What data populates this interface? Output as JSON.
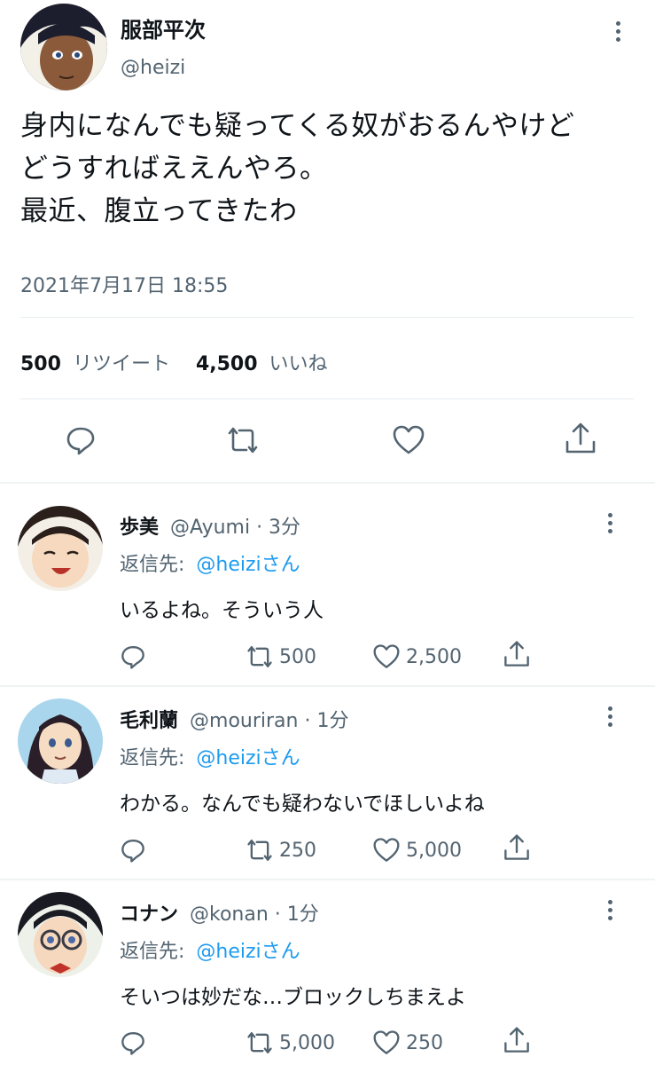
{
  "main_tweet": {
    "display_name": "服部平次",
    "handle": "@heizi",
    "text_lines": [
      "身内になんでも疑ってくる奴がおるんやけど",
      "どうすればええんやろ。",
      "最近、腹立ってきたわ"
    ],
    "timestamp": "2021年7月17日 18:55",
    "retweet_count": "500",
    "retweet_label": "リツイート",
    "like_count": "4,500",
    "like_label": "いいね"
  },
  "replies": [
    {
      "display_name": "歩美",
      "handle_time": "@Ayumi · 3分",
      "reply_prefix": "返信先:",
      "reply_to": "@heiziさん",
      "text": "いるよね。そういう人",
      "retweets": "500",
      "likes": "2,500"
    },
    {
      "display_name": "毛利蘭",
      "handle_time": "@mouriran · 1分",
      "reply_prefix": "返信先:",
      "reply_to": "@heiziさん",
      "text": "わかる。なんでも疑わないでほしいよね",
      "retweets": "250",
      "likes": "5,000"
    },
    {
      "display_name": "コナン",
      "handle_time": "@konan · 1分",
      "reply_prefix": "返信先:",
      "reply_to": "@heiziさん",
      "text": "そいつは妙だな…ブロックしちまえよ",
      "retweets": "5,000",
      "likes": "250"
    }
  ],
  "icons": {
    "reply": "reply-icon",
    "retweet": "retweet-icon",
    "like": "heart-icon",
    "share": "share-icon",
    "more": "more-vertical-icon"
  },
  "colors": {
    "text": "#0f1419",
    "secondary": "#536471",
    "link": "#1d9bf0",
    "divider": "#e6ecf0"
  }
}
